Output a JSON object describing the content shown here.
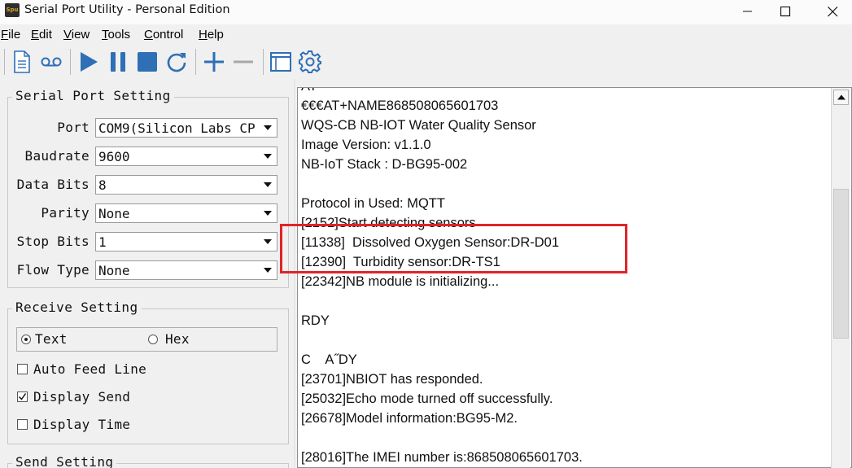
{
  "window": {
    "title": "Serial Port Utility - Personal Edition",
    "icon_text": "Spu"
  },
  "menu": [
    {
      "label": "File",
      "accel": "F",
      "rest": "ile"
    },
    {
      "label": "Edit",
      "accel": "E",
      "rest": "dit"
    },
    {
      "label": "View",
      "accel": "V",
      "rest": "iew"
    },
    {
      "label": "Tools",
      "accel": "T",
      "rest": "ools"
    },
    {
      "label": "Control",
      "accel": "C",
      "rest": "ontrol"
    },
    {
      "label": "Help",
      "accel": "H",
      "rest": "elp"
    }
  ],
  "toolbar": {
    "buttons": [
      "new-document-icon",
      "record-icon",
      "play-icon",
      "pause-icon",
      "stop-icon",
      "refresh-icon",
      "add-icon",
      "remove-icon",
      "window-icon",
      "settings-gear-icon"
    ],
    "accent": "#2e6fb5"
  },
  "serial_port_setting": {
    "title": "Serial Port Setting",
    "fields": [
      {
        "label": "Port",
        "value": "COM9(Silicon Labs CP"
      },
      {
        "label": "Baudrate",
        "value": "9600"
      },
      {
        "label": "Data Bits",
        "value": "8"
      },
      {
        "label": "Parity",
        "value": "None"
      },
      {
        "label": "Stop Bits",
        "value": "1"
      },
      {
        "label": "Flow Type",
        "value": "None"
      }
    ]
  },
  "receive_setting": {
    "title": "Receive Setting",
    "radio_text": "Text",
    "radio_hex": "Hex",
    "selected": "Text",
    "checkboxes": [
      {
        "label": "Auto Feed Line",
        "checked": false
      },
      {
        "label": "Display Send",
        "checked": true
      },
      {
        "label": "Display Time",
        "checked": false
      }
    ]
  },
  "send_setting": {
    "title": "Send Setting"
  },
  "terminal": {
    "lines": [
      "AT",
      "€€€AT+NAME868508065601703",
      "WQS-CB NB-IOT Water Quality Sensor",
      "Image Version: v1.1.0",
      "NB-IoT Stack : D-BG95-002",
      "",
      "Protocol in Used: MQTT",
      "[2152]Start detecting sensors",
      "[11338]  Dissolved Oxygen Sensor:DR-D01",
      "[12390]  Turbidity sensor:DR-TS1",
      "[22342]NB module is initializing...",
      "",
      "RDY",
      "",
      "C    A˝DY",
      "[23701]NBIOT has responded.",
      "[25032]Echo mode turned off successfully.",
      "[26678]Model information:BG95-M2.",
      "",
      "[28016]The IMEI number is:868508065601703."
    ],
    "highlight_color": "#e0242a"
  }
}
